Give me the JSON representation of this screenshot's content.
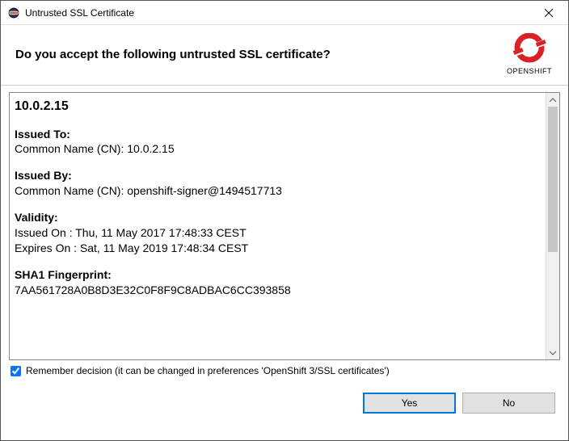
{
  "window": {
    "title": "Untrusted SSL Certificate"
  },
  "header": {
    "question": "Do you accept the following untrusted SSL certificate?",
    "logo_label": "OPENSHIFT"
  },
  "certificate": {
    "host": "10.0.2.15",
    "issued_to_label": "Issued To:",
    "issued_to_cn": "Common Name (CN): 10.0.2.15",
    "issued_by_label": "Issued By:",
    "issued_by_cn": "Common Name (CN): openshift-signer@1494517713",
    "validity_label": "Validity:",
    "issued_on": "Issued On : Thu, 11 May 2017 17:48:33 CEST",
    "expires_on": "Expires On : Sat, 11 May 2019 17:48:34 CEST",
    "fingerprint_label": "SHA1 Fingerprint:",
    "fingerprint_value": "7AA561728A0B8D3E32C0F8F9C8ADBAC6CC393858"
  },
  "remember": {
    "checked": true,
    "label": "Remember decision (it can be changed in preferences 'OpenShift 3/SSL certificates')"
  },
  "buttons": {
    "yes": "Yes",
    "no": "No"
  }
}
